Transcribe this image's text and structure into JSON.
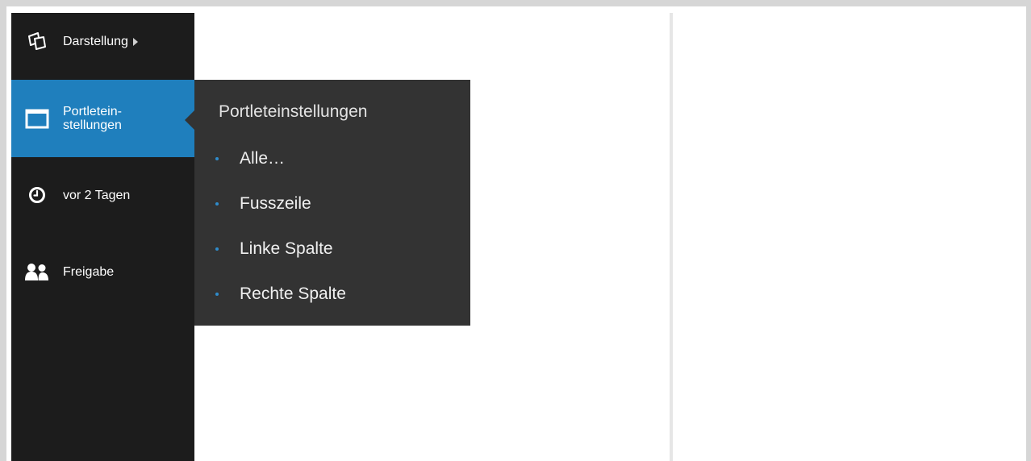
{
  "toolbar": {
    "items": [
      {
        "label": "Darstellung",
        "icon": "layers-icon",
        "has_submenu": true
      },
      {
        "label_line1": "Portletein-",
        "label_line2": "stellungen",
        "icon": "window-icon",
        "active": true
      },
      {
        "label": "vor 2 Tagen",
        "icon": "clock-icon"
      },
      {
        "label": "Freigabe",
        "icon": "users-icon"
      }
    ]
  },
  "submenu": {
    "title": "Portleteinstellungen",
    "items": [
      "Alle…",
      "Fusszeile",
      "Linke Spalte",
      "Rechte Spalte"
    ]
  },
  "colors": {
    "toolbar_bg": "#1c1c1c",
    "active_bg": "#1f7fbd",
    "submenu_bg": "#333333",
    "bullet": "#2f8ccc"
  }
}
